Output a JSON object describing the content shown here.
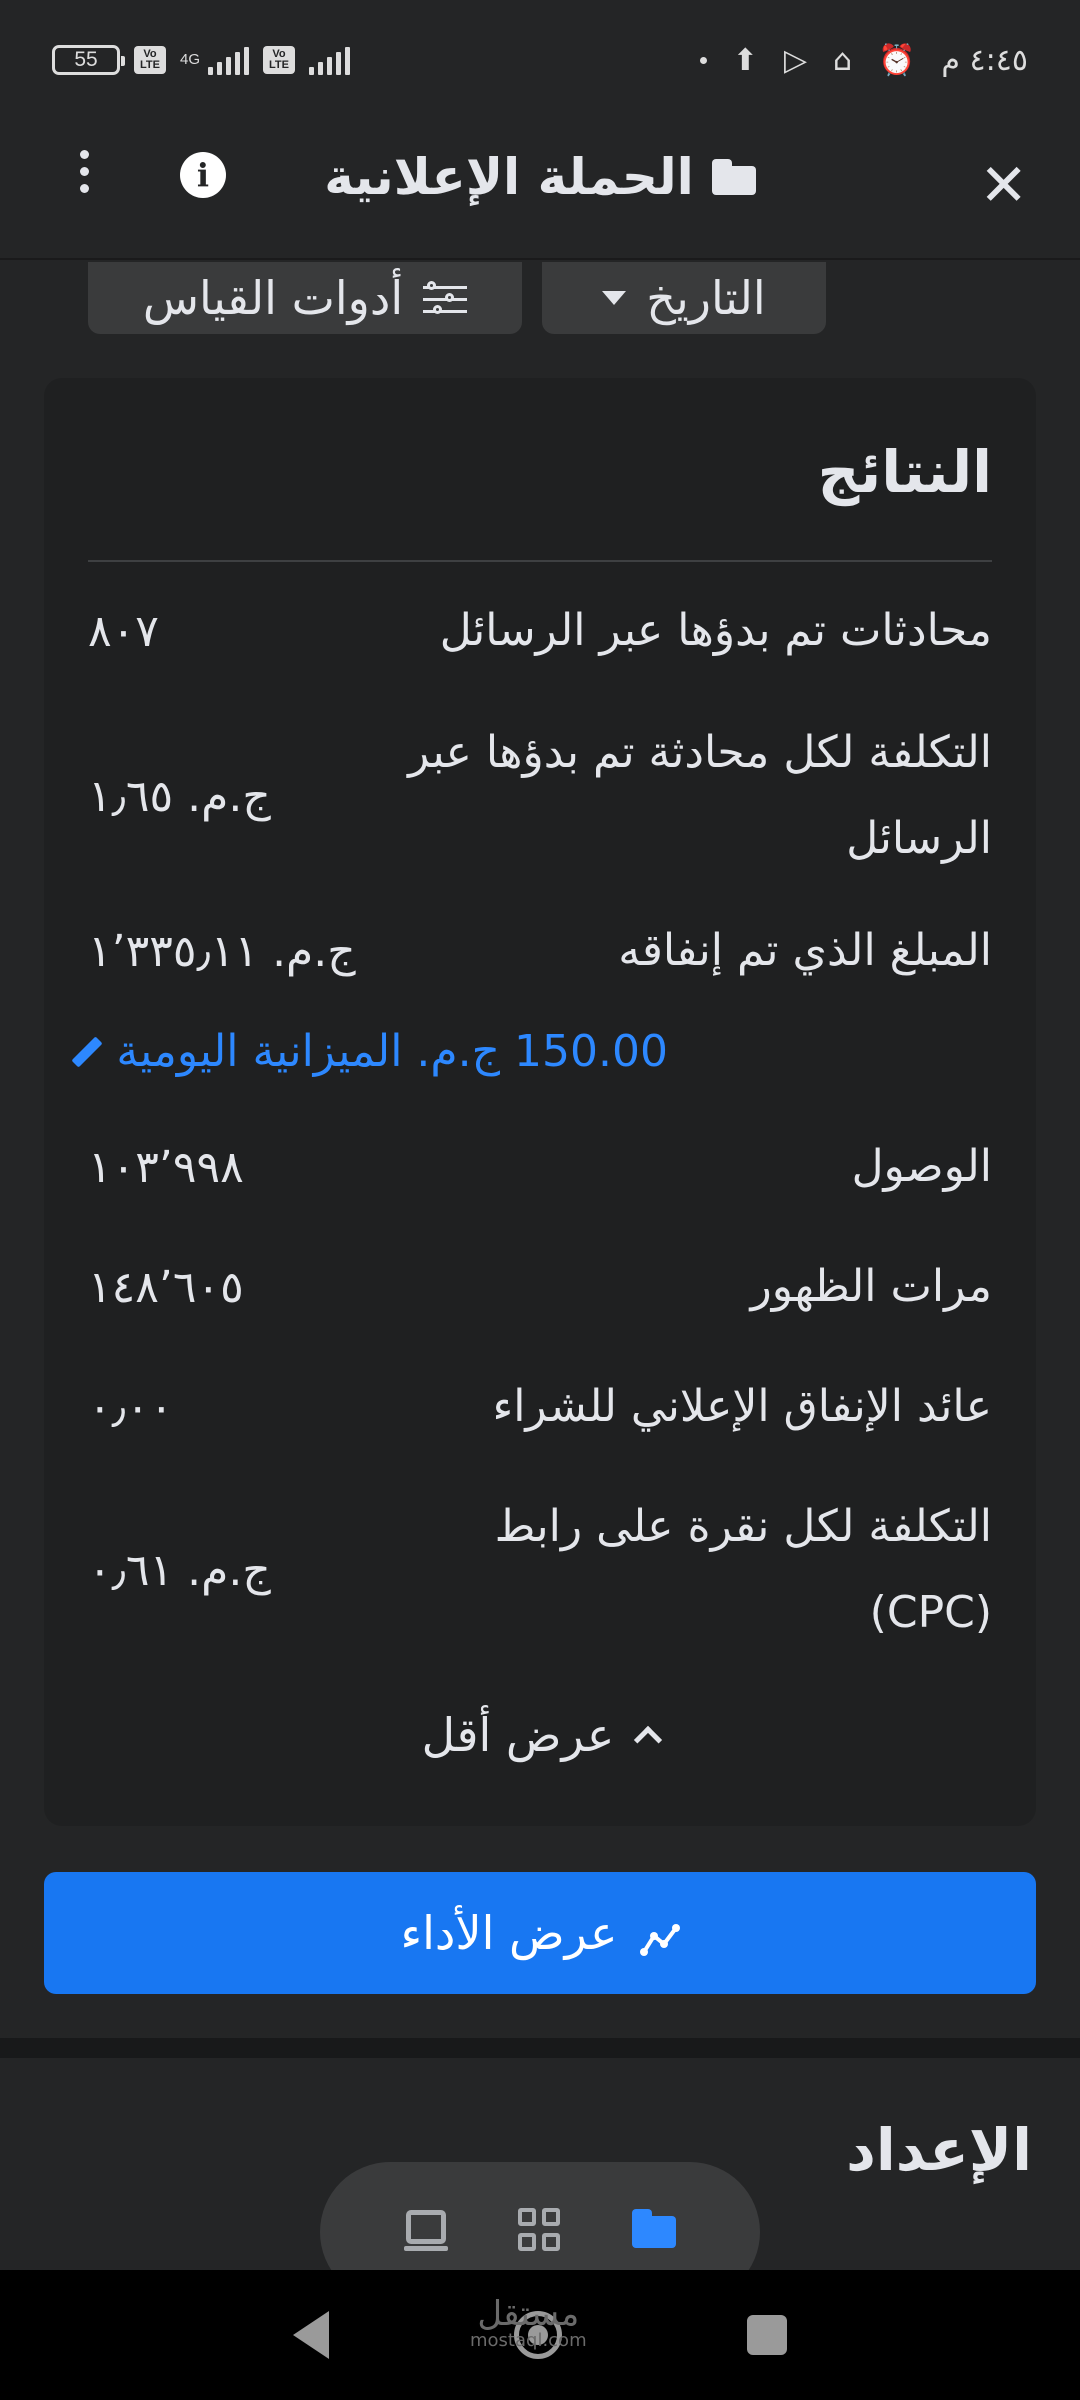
{
  "status_bar": {
    "time": "٤:٤٥ م",
    "battery": "55",
    "network_type": "4G",
    "volte_label": "Vo LTE",
    "icons": [
      "alarm-icon",
      "mosque-icon",
      "play-store-icon",
      "upload-icon",
      "dot-icon",
      "signal-icon",
      "volte-icon",
      "battery-icon"
    ]
  },
  "header": {
    "title": "الحملة الإعلانية",
    "icons": [
      "close-icon",
      "folder-icon",
      "info-icon",
      "more-icon"
    ]
  },
  "filters": {
    "date_label": "التاريخ",
    "tools_label": "أدوات القياس"
  },
  "results": {
    "title": "النتائج",
    "rows": [
      {
        "label": "محادثات تم بدؤها عبر الرسائل",
        "value": "٨٠٧"
      },
      {
        "label": "التكلفة لكل محادثة تم بدؤها عبر الرسائل",
        "value": "ج.م. ١٫٦٥"
      },
      {
        "label": "المبلغ الذي تم إنفاقه",
        "value": "ج.م. ١٬٣٣٥٫١١"
      },
      {
        "label": "الوصول",
        "value": "١٠٣٬٩٩٨"
      },
      {
        "label": "مرات الظهور",
        "value": "١٤٨٬٦٠٥"
      },
      {
        "label": "عائد الإنفاق الإعلاني للشراء",
        "value": "٠٫٠٠"
      },
      {
        "label": "التكلفة لكل نقرة على رابط (CPC)",
        "value": "ج.م. ٠٫٦١"
      }
    ],
    "budget_link": "150.00 ج.م. الميزانية اليومية",
    "show_less": "عرض أقل"
  },
  "performance_button": "عرض الأداء",
  "setup_title": "الإعداد",
  "bottom_tabs": [
    "laptop-icon",
    "grid-icon",
    "folder-icon"
  ],
  "watermark": {
    "main": "مستقل",
    "sub": "mostaql.com"
  },
  "colors": {
    "background": "#242526",
    "card": "#1f2021",
    "accent": "#1877f2",
    "link": "#2d88ff"
  }
}
